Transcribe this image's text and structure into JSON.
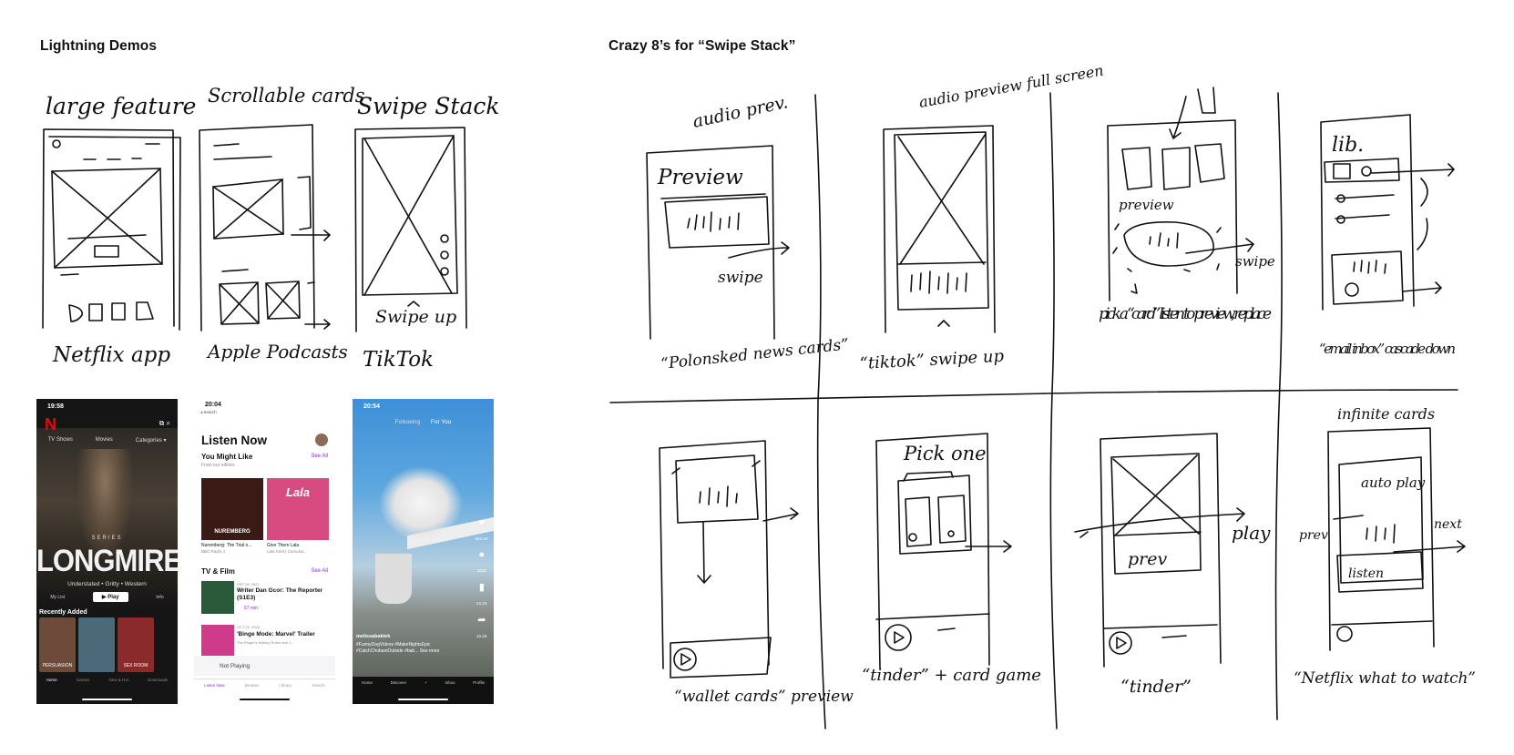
{
  "headings": {
    "left": "Lightning Demos",
    "right": "Crazy 8’s for “Swipe Stack”"
  },
  "demos": [
    {
      "title": "large feature",
      "caption": "Netflix app"
    },
    {
      "title": "Scrollable cards",
      "caption": "Apple Podcasts"
    },
    {
      "title": "Swipe Stack",
      "caption": "TikTok",
      "note": "Swipe up"
    }
  ],
  "crazy8": [
    {
      "top": "audio prev.",
      "inner": "Preview",
      "side": "swipe",
      "caption": "“Polonsked news cards”"
    },
    {
      "top": "audio preview full screen",
      "caption": "“tiktok” swipe up"
    },
    {
      "inner": "preview",
      "side": "swipe",
      "caption": "pick a “card” listen to preview, replace"
    },
    {
      "inner": "lib.",
      "caption": "“email inbox” cascade down"
    },
    {
      "caption": "“wallet cards” preview"
    },
    {
      "top": "Pick one",
      "caption": "“tinder” + card game"
    },
    {
      "inner": "prev",
      "side": "play",
      "caption": "“tinder”"
    },
    {
      "top": "infinite cards",
      "inner": "auto play",
      "inner2": "listen",
      "left": "prev",
      "right": "next",
      "caption": "“Netflix what to watch”"
    }
  ],
  "netflix": {
    "time": "19:58",
    "logo": "N",
    "categories": [
      "TV Shows",
      "Movies",
      "Categories ▾"
    ],
    "series_label": "SERIES",
    "show_title": "LONGMIRE",
    "tags": "Understated • Gritty • Western",
    "my_list": "My List",
    "play": "▶ Play",
    "info": "Info",
    "recently_added": "Recently Added",
    "thumbs": [
      {
        "label": "PERSUASION",
        "color": "#6d4a3a"
      },
      {
        "label": "",
        "color": "#4a6a7a"
      },
      {
        "label": "SEX ROOM",
        "color": "#8a2a2a"
      },
      {
        "label": "",
        "color": "#5a3a5a"
      }
    ],
    "tabs": [
      "Home",
      "Games",
      "New & Hot",
      "Downloads"
    ]
  },
  "podcasts": {
    "time": "20:04",
    "back": "◂ Search",
    "heading": "Listen Now",
    "s1_title": "You Might Like",
    "s1_sub": "From our editors",
    "see_all": "See All",
    "card1_art": "NUREMBERG",
    "card2_art": "Lala",
    "card1_title": "Nuremberg: The Trial o...",
    "card1_sub": "BBC Radio 4",
    "card2_title": "Give Them Lala",
    "card2_sub": "Lala Kent | Cumulus...",
    "s2_title": "TV & Film",
    "ep1_date": "SEP 29, 2021",
    "ep1_title": "Writer Dan Gcor: The Reporter (S1E3)",
    "ep1_len": "57 min",
    "ep2_date": "OCT 22, 2020",
    "ep2_title": "'Binge Mode: Marvel' Trailer",
    "ep2_sub": "The Ringer's Mallory Rubin and J...",
    "now_playing": "Not Playing",
    "tabs": [
      "Listen Now",
      "Browse",
      "Library",
      "Search"
    ]
  },
  "tiktok": {
    "time": "20:54",
    "tab_following": "Following",
    "tab_foryou": "For You",
    "likes": "601.1K",
    "comments": "3310",
    "saves": "24.1K",
    "shares": "10.2K",
    "user": "melissabaklek",
    "caption": "#FunnyDogVideos #MakeNightsEpic #CatchChobaniOutside #bab... See more",
    "tabs": [
      "Home",
      "Discover",
      "+",
      "Inbox",
      "Profile"
    ]
  }
}
